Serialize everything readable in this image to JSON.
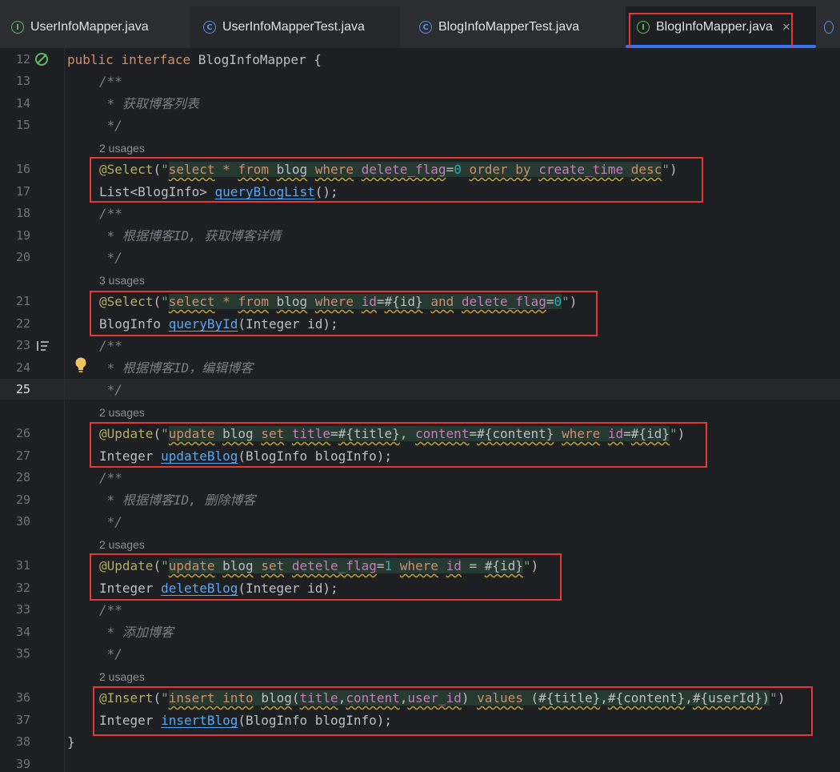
{
  "tabs": [
    {
      "name": "tab-userinfomapper",
      "label": "UserInfoMapper.java",
      "icon": "I",
      "kind": "interface"
    },
    {
      "name": "tab-userinfomappertest",
      "label": "UserInfoMapperTest.java",
      "icon": "C",
      "kind": "class"
    },
    {
      "name": "tab-bloginfomappertest",
      "label": "BlogInfoMapperTest.java",
      "icon": "C",
      "kind": "class"
    },
    {
      "name": "tab-bloginfomapper",
      "label": "BlogInfoMapper.java",
      "icon": "I",
      "kind": "interface",
      "active": true,
      "close": "×"
    }
  ],
  "editor": {
    "current_line": "25",
    "lines": {
      "l12": "12",
      "l13": "13",
      "l14": "14",
      "l15": "15",
      "l16": "16",
      "l17": "17",
      "l18": "18",
      "l19": "19",
      "l20": "20",
      "l21": "21",
      "l22": "22",
      "l23": "23",
      "l24": "24",
      "l25": "25",
      "l26": "26",
      "l27": "27",
      "l28": "28",
      "l29": "29",
      "l30": "30",
      "l31": "31",
      "l32": "32",
      "l33": "33",
      "l34": "34",
      "l35": "35",
      "l36": "36",
      "l37": "37",
      "l38": "38",
      "l39": "39"
    },
    "usages": {
      "u1": "2 usages",
      "u2": "3 usages",
      "u3": "2 usages",
      "u4": "2 usages",
      "u5": "2 usages"
    },
    "code": {
      "decl_public": "public",
      "decl_interface": "interface",
      "decl_name": " BlogInfoMapper {",
      "c1_open": "/**",
      "c1_text": " * 获取博客列表",
      "c1_close": " */",
      "c2_open": "/**",
      "c2_text": " * 根据博客ID, 获取博客详情",
      "c2_close": " */",
      "c3_open": "/**",
      "c3_text": " * 根据博客ID，编辑博客",
      "c3_close": " */",
      "c4_open": "/**",
      "c4_text": " * 根据博客ID, 删除博客",
      "c4_close": " */",
      "c5_open": "/**",
      "c5_text": " * 添加博客",
      "c5_close": " */",
      "ann_select": "@Select",
      "ann_update": "@Update",
      "ann_insert": "@Insert",
      "close_brace": "}",
      "m1_ret": "List<BlogInfo> ",
      "m1_name": "queryBlogList",
      "m1_args": "();",
      "m2_ret": "BlogInfo ",
      "m2_name": "queryById",
      "m2_args": "(Integer id);",
      "m3_ret": "Integer ",
      "m3_name": "updateBlog",
      "m3_args": "(BlogInfo blogInfo);",
      "m4_ret": "Integer ",
      "m4_name": "deleteBlog",
      "m4_args": "(Integer id);",
      "m5_ret": "Integer ",
      "m5_name": "insertBlog",
      "m5_args": "(BlogInfo blogInfo);"
    }
  },
  "colors": {
    "highlight_box": "#e53935",
    "active_tab_underline": "#3574f0"
  }
}
